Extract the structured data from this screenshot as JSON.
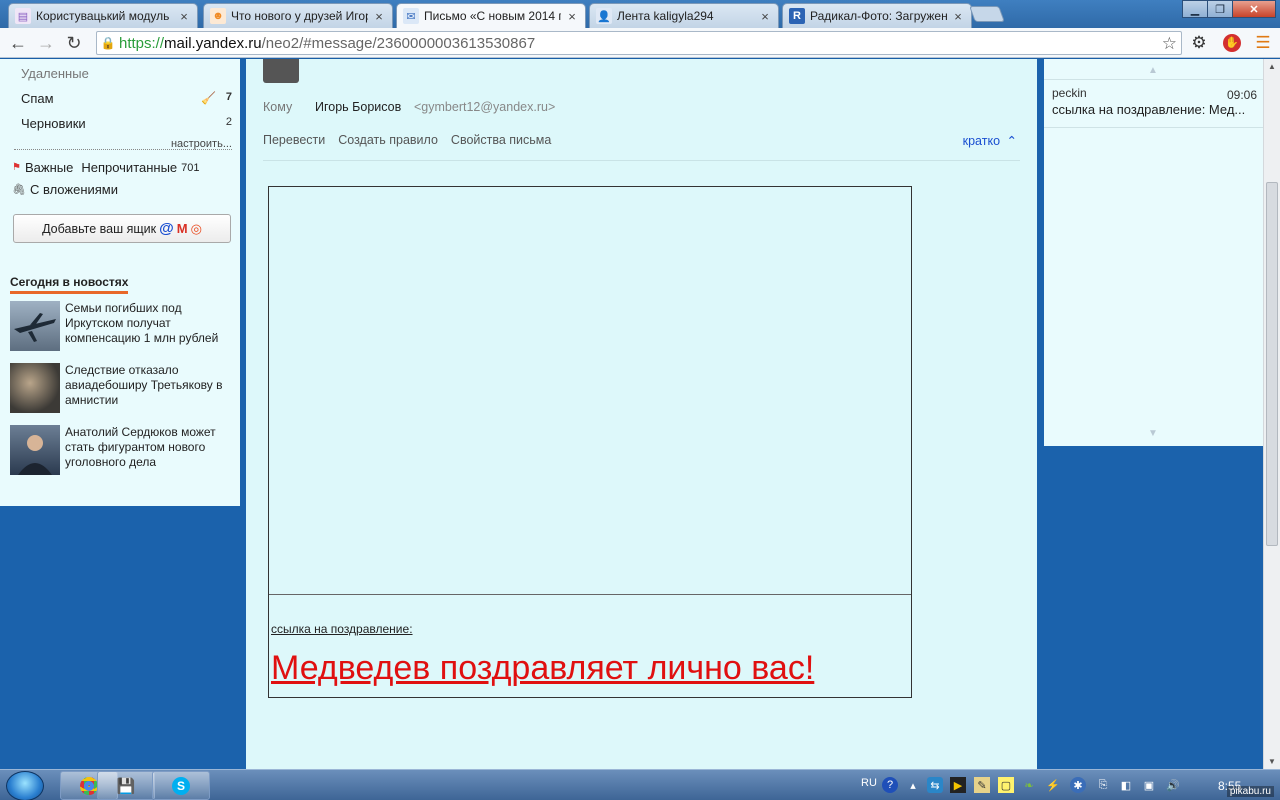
{
  "browser": {
    "tabs": [
      {
        "title": "Користувацький модуль",
        "icon": "doc-icon",
        "color": "#8a5fc2"
      },
      {
        "title": "Что нового у друзей Игор",
        "icon": "odnoklassniki-icon",
        "color": "#f08a24"
      },
      {
        "title": "Письмо «С новым 2014 г",
        "icon": "mail-icon",
        "color": "#5a8fd0"
      },
      {
        "title": "Лента kaligyla294",
        "icon": "user-icon",
        "color": "#2d56a0"
      },
      {
        "title": "Радикал-Фото: Загружен",
        "icon": "radikal-icon",
        "color": "#2b63b4"
      }
    ],
    "url": {
      "scheme": "https://",
      "host": "mail.yandex.ru",
      "path": "/neo2/#message/2360000003613530867"
    },
    "window_controls": {
      "minimize": "▁",
      "maximize": "❐",
      "close": "✕"
    }
  },
  "sidebar": {
    "folders": [
      {
        "label": "Удаленные",
        "count": ""
      },
      {
        "label": "Спам",
        "count": "7"
      },
      {
        "label": "Черновики",
        "count": "2"
      }
    ],
    "settings_link": "настроить...",
    "filters": {
      "important": "Важные",
      "unread": "Непрочитанные",
      "unread_count": "701",
      "attachments": "С вложениями"
    },
    "add_box": "Добавьте ваш ящик",
    "news_heading": "Сегодня в новостях",
    "news": [
      {
        "text": "Семьи погибших под Иркутском получат компенсацию 1 млн рублей"
      },
      {
        "text": "Следствие отказало авиадебоширу Третьякову в амнистии"
      },
      {
        "text": "Анатолий Сердюков может стать фигурантом нового уголовного дела"
      }
    ]
  },
  "message": {
    "to_label": "Кому",
    "to_name": "Игорь Борисов",
    "to_email": "<gymbert12@yandex.ru>",
    "actions": [
      "Перевести",
      "Создать правило",
      "Свойства письма"
    ],
    "brief": "кратко",
    "caption": "ссылка на поздравление:",
    "link_text": "Медведев поздравляет лично вас!"
  },
  "thread": {
    "from": "peckin",
    "time": "09:06",
    "subject": "ссылка на поздравление: Мед..."
  },
  "taskbar": {
    "lang": "RU",
    "clock": "8:55",
    "watermark": "pikabu.ru"
  },
  "colors": {
    "accent_link": "#1a4fd1",
    "message_link": "#e01010",
    "pane_bg": "#ddf8fa",
    "page_bg": "#1b62ac"
  }
}
